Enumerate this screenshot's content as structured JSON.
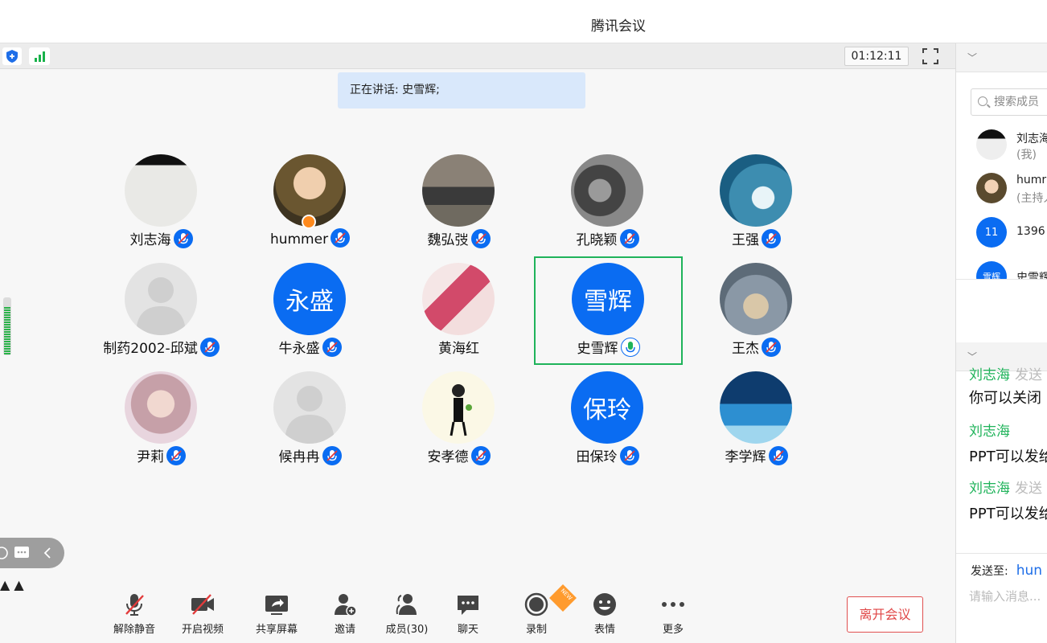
{
  "window": {
    "title": "腾讯会议"
  },
  "status": {
    "timer": "01:12:11"
  },
  "speaking": {
    "text": "正在讲话: 史雪辉;"
  },
  "participants": [
    {
      "name": "刘志海",
      "avatar": "photo-white",
      "mic": "muted"
    },
    {
      "name": "hummer",
      "avatar": "photo-baby",
      "mic": "muted",
      "host": true
    },
    {
      "name": "魏弘弢",
      "avatar": "photo-man",
      "mic": "muted"
    },
    {
      "name": "孔晓颖",
      "avatar": "photo-rock",
      "mic": "muted"
    },
    {
      "name": "王强",
      "avatar": "photo-wave",
      "mic": "muted"
    },
    {
      "name": "制药2002-邱斌",
      "avatar": "default-person",
      "mic": "muted"
    },
    {
      "name": "牛永盛",
      "avatar_text": "永盛",
      "mic": "muted"
    },
    {
      "name": "黄海红",
      "avatar": "photo-child",
      "mic": "none"
    },
    {
      "name": "史雪辉",
      "avatar_text": "雪辉",
      "mic": "speaking",
      "active": true
    },
    {
      "name": "王杰",
      "avatar": "photo-couple",
      "mic": "muted"
    },
    {
      "name": "尹莉",
      "avatar": "photo-woman",
      "mic": "muted"
    },
    {
      "name": "候冉冉",
      "avatar": "default-person",
      "mic": "muted"
    },
    {
      "name": "安孝德",
      "avatar": "photo-cartoon",
      "mic": "muted"
    },
    {
      "name": "田保玲",
      "avatar_text": "保玲",
      "mic": "muted"
    },
    {
      "name": "李学辉",
      "avatar": "photo-whale",
      "mic": "muted"
    }
  ],
  "toolbar": {
    "unmute": "解除静音",
    "start_video": "开启视频",
    "share_screen": "共享屏幕",
    "invite": "邀请",
    "members": "成员(30)",
    "chat": "聊天",
    "record": "录制",
    "new_badge": "NEW",
    "reactions": "表情",
    "more": "更多",
    "leave": "离开会议"
  },
  "members_panel": {
    "search_placeholder": "搜索成员",
    "items": [
      {
        "name": "刘志海",
        "sub": "(我)"
      },
      {
        "name": "humr",
        "sub": "(主持人"
      },
      {
        "avatar_text": "11",
        "name": "1396"
      },
      {
        "avatar_text": "雪辉",
        "name": "史雪辉"
      }
    ]
  },
  "chat_panel": {
    "messages": [
      {
        "sender": "刘志海",
        "action": "发送",
        "text": "你可以关闭"
      },
      {
        "sender": "刘志海",
        "action": "",
        "text": "PPT可以发给"
      },
      {
        "sender": "刘志海",
        "action": "发送",
        "text": "PPT可以发给"
      }
    ],
    "send_to_label": "发送至:",
    "send_to_target": "hun",
    "input_placeholder": "请输入消息..."
  },
  "colors": {
    "accent": "#0a6cf2",
    "speaking_green": "#1fb35a",
    "leave_red": "#e04646"
  }
}
